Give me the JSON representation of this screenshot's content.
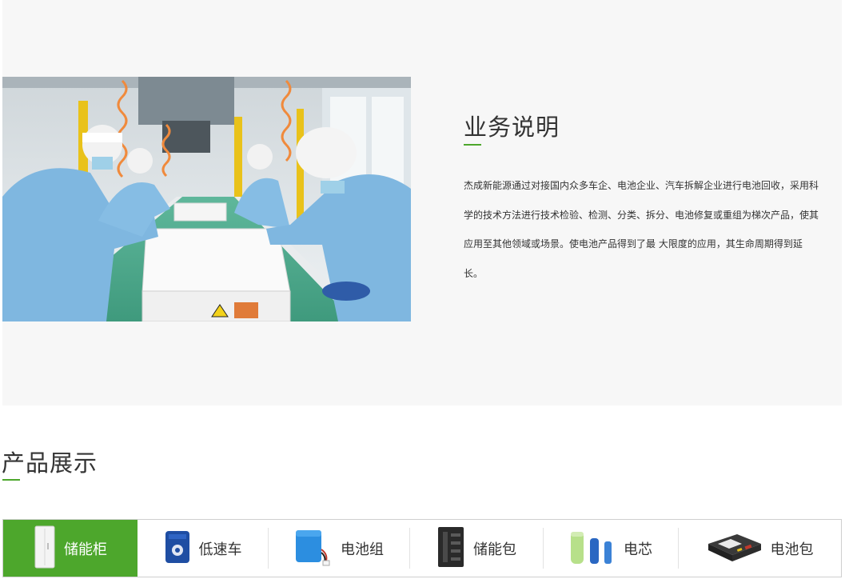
{
  "business": {
    "title": "业务说明",
    "description": "杰成新能源通过对接国内众多车企、电池企业、汽车拆解企业进行电池回收，采用科学的技术方法进行技术检验、检测、分类、拆分、电池修复或重组为梯次产品，使其应用至其他领域或场景。使电池产品得到了最 大限度的应用，其生命周期得到延长。",
    "image_icon": "factory-workers-photo"
  },
  "products": {
    "title": "产品展示",
    "tabs": [
      {
        "label": "储能柜",
        "icon": "storage-cabinet-icon",
        "active": true
      },
      {
        "label": "低速车",
        "icon": "low-speed-vehicle-battery-icon",
        "active": false
      },
      {
        "label": "电池组",
        "icon": "battery-pack-icon",
        "active": false
      },
      {
        "label": "储能包",
        "icon": "storage-pack-icon",
        "active": false
      },
      {
        "label": "电芯",
        "icon": "battery-cell-icon",
        "active": false
      },
      {
        "label": "电池包",
        "icon": "ev-battery-pack-icon",
        "active": false
      }
    ]
  },
  "colors": {
    "accent": "#4da72c",
    "section_background": "#f7f7f7",
    "text": "#333333"
  }
}
